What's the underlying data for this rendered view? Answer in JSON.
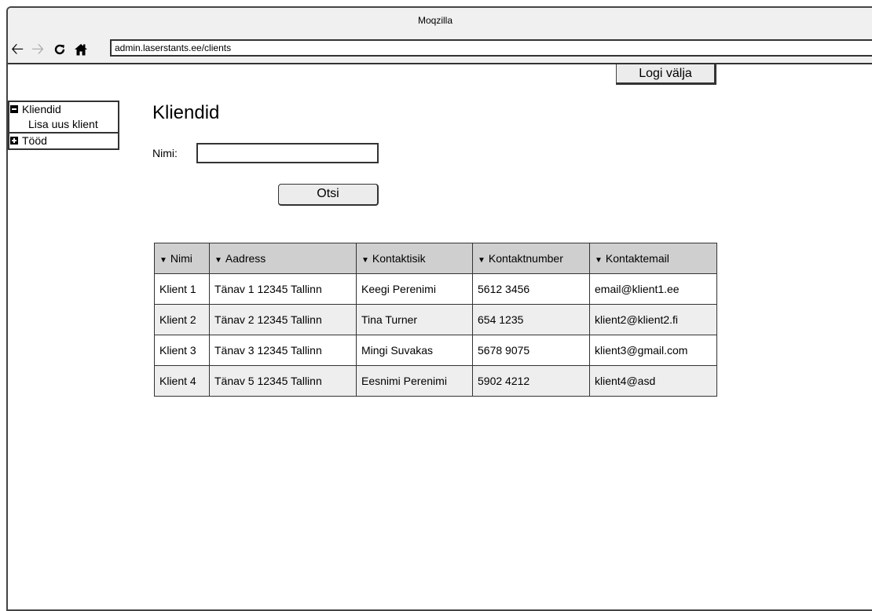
{
  "window": {
    "title": "Moqzilla"
  },
  "nav": {
    "back_icon": "back-arrow-icon",
    "forward_icon": "forward-arrow-icon",
    "reload_icon": "reload-icon",
    "home_icon": "home-icon",
    "url": "admin.laserstants.ee/clients"
  },
  "header": {
    "logout_label": "Logi välja"
  },
  "sidebar": {
    "groups": [
      {
        "label": "Kliendid",
        "expanded": true,
        "items": [
          "Lisa uus klient"
        ]
      },
      {
        "label": "Tööd",
        "expanded": false,
        "items": []
      }
    ]
  },
  "main": {
    "title": "Kliendid",
    "search": {
      "label": "Nimi:",
      "value": "",
      "button_label": "Otsi"
    },
    "table": {
      "columns": [
        "Nimi",
        "Aadress",
        "Kontaktisik",
        "Kontaktnumber",
        "Kontaktemail"
      ],
      "rows": [
        [
          "Klient 1",
          "Tänav 1 12345 Tallinn",
          "Keegi Perenimi",
          "5612 3456",
          "email@klient1.ee"
        ],
        [
          "Klient 2",
          "Tänav 2 12345 Tallinn",
          "Tina Turner",
          "654 1235",
          "klient2@klient2.fi"
        ],
        [
          "Klient 3",
          "Tänav 3 12345 Tallinn",
          "Mingi Suvakas",
          "5678 9075",
          "klient3@gmail.com"
        ],
        [
          "Klient 4",
          "Tänav 5 12345 Tallinn",
          "Eesnimi Perenimi",
          "5902 4212",
          "klient4@asd"
        ]
      ]
    }
  }
}
